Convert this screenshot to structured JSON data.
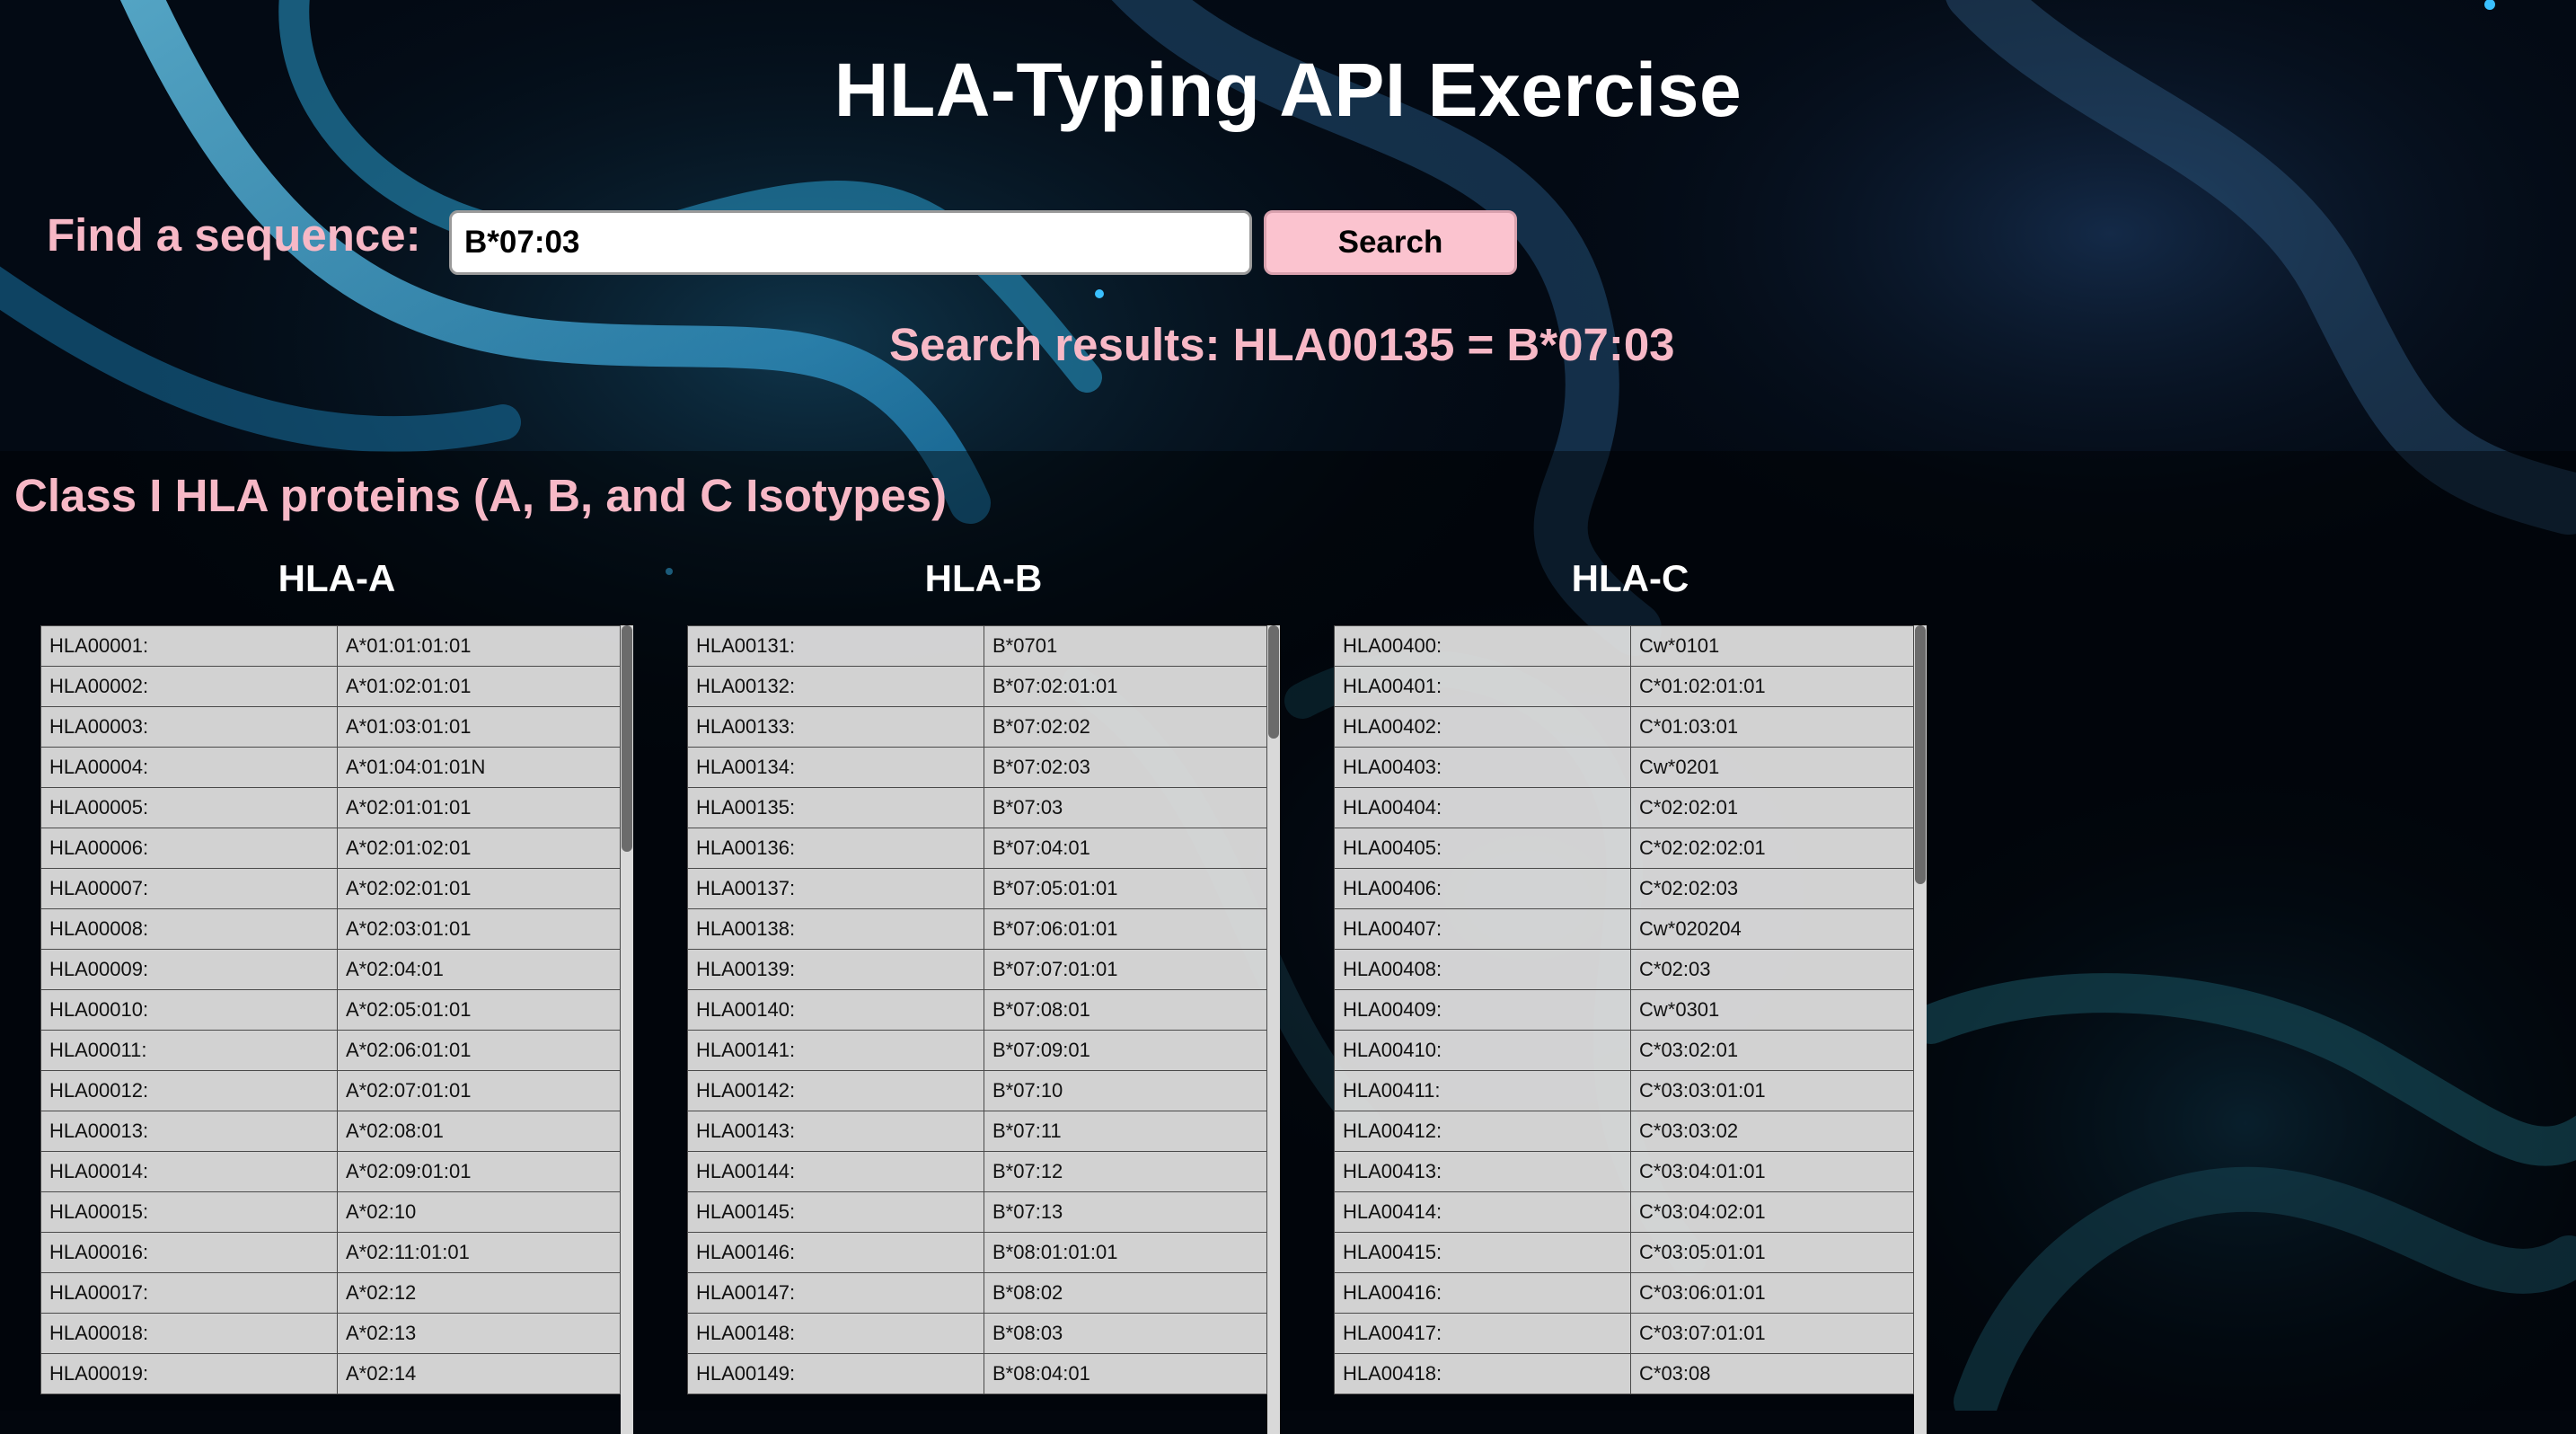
{
  "header": {
    "title": "HLA-Typing API Exercise",
    "search_label": "Find a sequence:",
    "search_value": "B*07:03",
    "search_button": "Search",
    "results_text": "Search results: HLA00135 = B*07:03"
  },
  "section": {
    "heading": "Class I HLA proteins (A, B, and C Isotypes)"
  },
  "colors": {
    "accent_pink": "#f7b8c6",
    "button_pink": "#fbc3cf",
    "title_white": "#ffffff"
  },
  "columns": [
    {
      "title": "HLA-A",
      "rows": [
        [
          "HLA00001:",
          "A*01:01:01:01"
        ],
        [
          "HLA00002:",
          "A*01:02:01:01"
        ],
        [
          "HLA00003:",
          "A*01:03:01:01"
        ],
        [
          "HLA00004:",
          "A*01:04:01:01N"
        ],
        [
          "HLA00005:",
          "A*02:01:01:01"
        ],
        [
          "HLA00006:",
          "A*02:01:02:01"
        ],
        [
          "HLA00007:",
          "A*02:02:01:01"
        ],
        [
          "HLA00008:",
          "A*02:03:01:01"
        ],
        [
          "HLA00009:",
          "A*02:04:01"
        ],
        [
          "HLA00010:",
          "A*02:05:01:01"
        ],
        [
          "HLA00011:",
          "A*02:06:01:01"
        ],
        [
          "HLA00012:",
          "A*02:07:01:01"
        ],
        [
          "HLA00013:",
          "A*02:08:01"
        ],
        [
          "HLA00014:",
          "A*02:09:01:01"
        ],
        [
          "HLA00015:",
          "A*02:10"
        ],
        [
          "HLA00016:",
          "A*02:11:01:01"
        ],
        [
          "HLA00017:",
          "A*02:12"
        ],
        [
          "HLA00018:",
          "A*02:13"
        ],
        [
          "HLA00019:",
          "A*02:14"
        ]
      ],
      "scroll_position": 0.0,
      "scroll_visible_fraction": 0.28
    },
    {
      "title": "HLA-B",
      "rows": [
        [
          "HLA00131:",
          "B*0701"
        ],
        [
          "HLA00132:",
          "B*07:02:01:01"
        ],
        [
          "HLA00133:",
          "B*07:02:02"
        ],
        [
          "HLA00134:",
          "B*07:02:03"
        ],
        [
          "HLA00135:",
          "B*07:03"
        ],
        [
          "HLA00136:",
          "B*07:04:01"
        ],
        [
          "HLA00137:",
          "B*07:05:01:01"
        ],
        [
          "HLA00138:",
          "B*07:06:01:01"
        ],
        [
          "HLA00139:",
          "B*07:07:01:01"
        ],
        [
          "HLA00140:",
          "B*07:08:01"
        ],
        [
          "HLA00141:",
          "B*07:09:01"
        ],
        [
          "HLA00142:",
          "B*07:10"
        ],
        [
          "HLA00143:",
          "B*07:11"
        ],
        [
          "HLA00144:",
          "B*07:12"
        ],
        [
          "HLA00145:",
          "B*07:13"
        ],
        [
          "HLA00146:",
          "B*08:01:01:01"
        ],
        [
          "HLA00147:",
          "B*08:02"
        ],
        [
          "HLA00148:",
          "B*08:03"
        ],
        [
          "HLA00149:",
          "B*08:04:01"
        ]
      ],
      "scroll_position": 0.0,
      "scroll_visible_fraction": 0.14
    },
    {
      "title": "HLA-C",
      "rows": [
        [
          "HLA00400:",
          "Cw*0101"
        ],
        [
          "HLA00401:",
          "C*01:02:01:01"
        ],
        [
          "HLA00402:",
          "C*01:03:01"
        ],
        [
          "HLA00403:",
          "Cw*0201"
        ],
        [
          "HLA00404:",
          "C*02:02:01"
        ],
        [
          "HLA00405:",
          "C*02:02:02:01"
        ],
        [
          "HLA00406:",
          "C*02:02:03"
        ],
        [
          "HLA00407:",
          "Cw*020204"
        ],
        [
          "HLA00408:",
          "C*02:03"
        ],
        [
          "HLA00409:",
          "Cw*0301"
        ],
        [
          "HLA00410:",
          "C*03:02:01"
        ],
        [
          "HLA00411:",
          "C*03:03:01:01"
        ],
        [
          "HLA00412:",
          "C*03:03:02"
        ],
        [
          "HLA00413:",
          "C*03:04:01:01"
        ],
        [
          "HLA00414:",
          "C*03:04:02:01"
        ],
        [
          "HLA00415:",
          "C*03:05:01:01"
        ],
        [
          "HLA00416:",
          "C*03:06:01:01"
        ],
        [
          "HLA00417:",
          "C*03:07:01:01"
        ],
        [
          "HLA00418:",
          "C*03:08"
        ]
      ],
      "scroll_position": 0.0,
      "scroll_visible_fraction": 0.32
    }
  ]
}
